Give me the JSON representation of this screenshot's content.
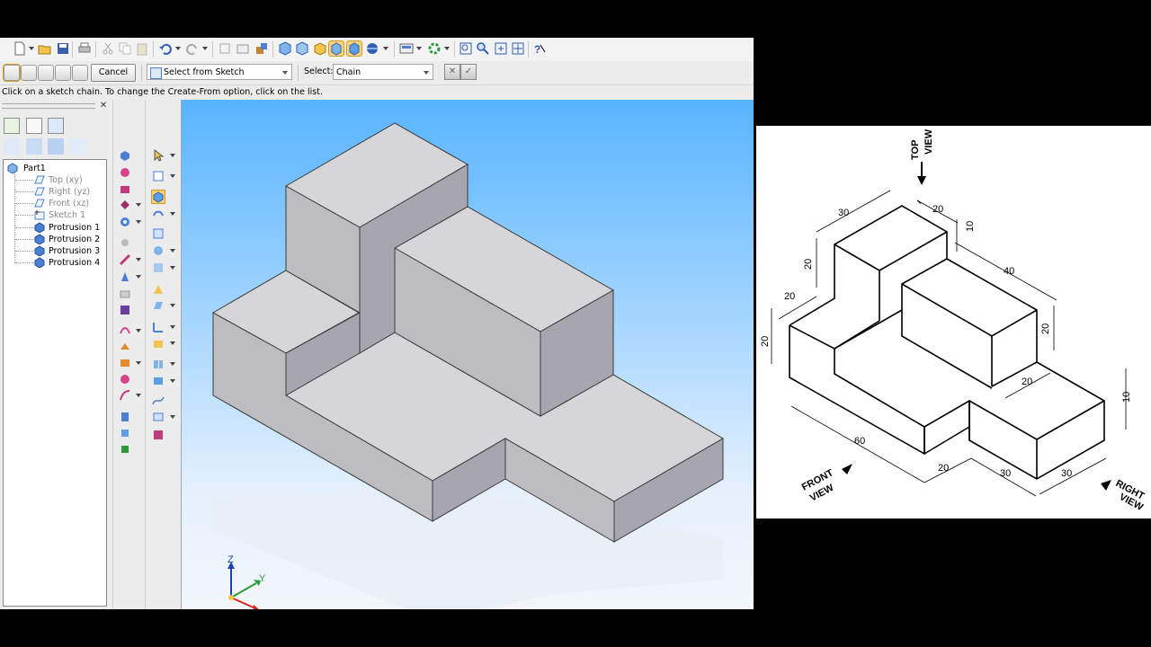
{
  "toolbar2": {
    "cancel_label": "Cancel",
    "create_from_value": "Select from Sketch",
    "select_label": "Select:",
    "select_value": "Chain"
  },
  "status_text": "Click on a sketch chain.  To change the Create-From option, click on the list.",
  "tree": {
    "root": "Part1",
    "items": [
      {
        "label": "Top (xy)",
        "dimmed": true
      },
      {
        "label": "Right (yz)",
        "dimmed": true
      },
      {
        "label": "Front (xz)",
        "dimmed": true
      },
      {
        "label": "Sketch 1",
        "dimmed": true
      },
      {
        "label": "Protrusion 1",
        "dimmed": false
      },
      {
        "label": "Protrusion 2",
        "dimmed": false
      },
      {
        "label": "Protrusion 3",
        "dimmed": false
      },
      {
        "label": "Protrusion 4",
        "dimmed": false
      }
    ]
  },
  "triad": {
    "z": "Z",
    "y": "Y",
    "x": "X"
  },
  "drawing": {
    "top_view_line1": "TOP",
    "top_view_line2": "VIEW",
    "front_view_line1": "FRONT",
    "front_view_line2": "VIEW",
    "right_view_line1": "RIGHT",
    "right_view_line2": "VIEW",
    "dims": [
      "30",
      "20",
      "10",
      "20",
      "40",
      "20",
      "20",
      "20",
      "20",
      "60",
      "20",
      "30",
      "30",
      "10"
    ]
  },
  "colors": {
    "top_face": "#d6d6d8",
    "front_face": "#bdbdc0",
    "right_face": "#a7a6b0",
    "highlight": "#f6d37a"
  }
}
